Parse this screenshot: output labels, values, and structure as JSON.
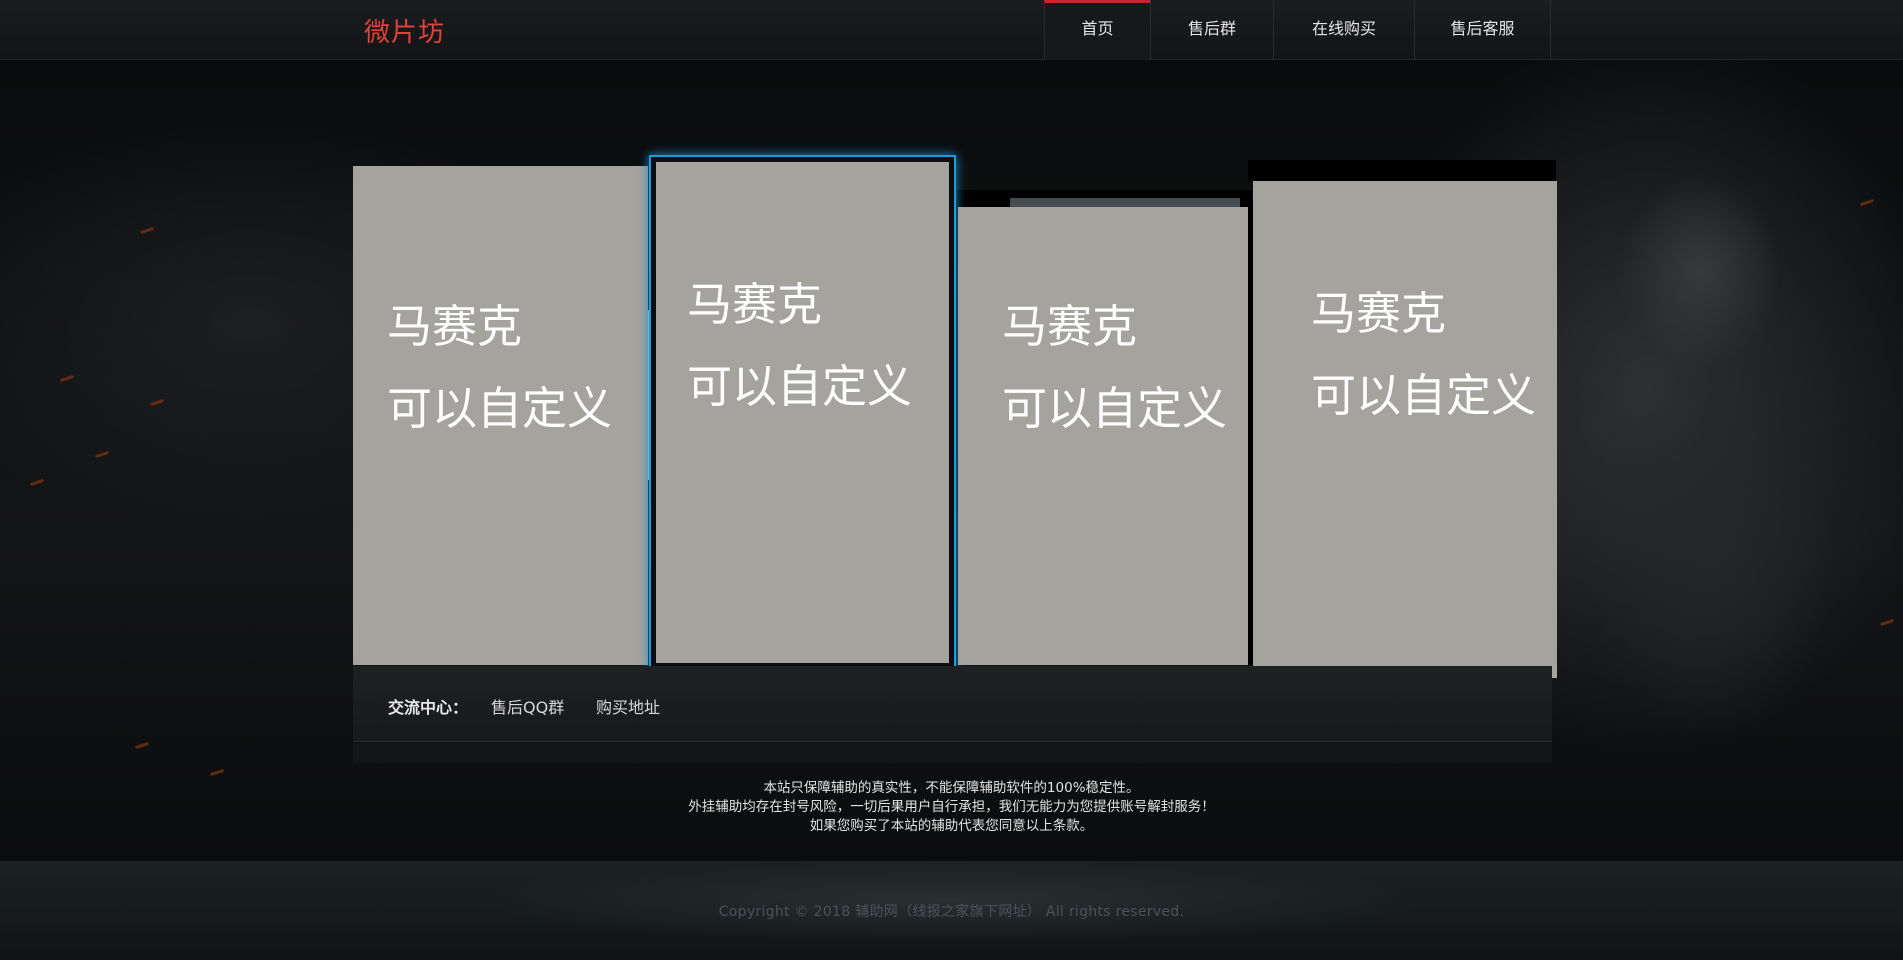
{
  "header": {
    "logo": "微片坊",
    "nav": [
      {
        "label": "首页",
        "active": true
      },
      {
        "label": "售后群"
      },
      {
        "label": "在线购买"
      },
      {
        "label": "售后客服"
      }
    ]
  },
  "cards": [
    {
      "line1": "马赛克",
      "line2": "可以自定义"
    },
    {
      "line1": "马赛克",
      "line2": "可以自定义"
    },
    {
      "line1": "马赛克",
      "line2": "可以自定义"
    },
    {
      "line1": "马赛克",
      "line2": "可以自定义"
    }
  ],
  "exchange": {
    "title": "交流中心：",
    "links": [
      "售后QQ群",
      "购买地址"
    ]
  },
  "disclaimer": [
    "本站只保障辅助的真实性，不能保障辅助软件的100%稳定性。",
    "外挂辅助均存在封号风险，一切后果用户自行承担，我们无能力为您提供账号解封服务！",
    "如果您购买了本站的辅助代表您同意以上条款。"
  ],
  "footer": {
    "copyright": "Copyright © 2018 辅助网（线报之家旗下网址） All rights reserved."
  },
  "colors": {
    "logo": "#e0413a",
    "nav_active": "#d3202a",
    "card_bg": "#a5a39e",
    "card_highlight": "#1e9bd8"
  }
}
